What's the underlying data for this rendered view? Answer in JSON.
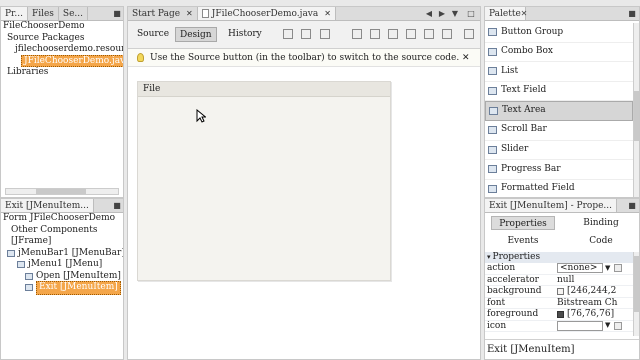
{
  "projects_panel": {
    "tabs": [
      "Pr...",
      "Files",
      "Se..."
    ],
    "tree": [
      "FileChooserDemo",
      "Source Packages",
      "jfilechooserdemo.resource",
      "JFileChooserDemo.java",
      "Libraries"
    ],
    "selected_index": 3
  },
  "navigator_panel": {
    "title": "Exit [JMenuItem...",
    "tree": [
      "Form JFileChooserDemo",
      "Other Components",
      "[JFrame]",
      "jMenuBar1 [JMenuBar]",
      "jMenu1 [JMenu]",
      "Open [JMenuItem]",
      "Exit [JMenuItem]"
    ],
    "selected_index": 6
  },
  "editor": {
    "tabs": [
      "Start Page",
      "JFileChooserDemo.java"
    ],
    "views": [
      "Source",
      "Design",
      "History"
    ],
    "active_view": "Design",
    "info": "Use the Source button (in the toolbar) to switch to the source code.",
    "menu_label": "File"
  },
  "palette": {
    "title": "Palette",
    "items": [
      "Button Group",
      "Combo Box",
      "List",
      "Text Field",
      "Text Area",
      "Scroll Bar",
      "Slider",
      "Progress Bar",
      "Formatted Field"
    ],
    "highlight": "Text Area"
  },
  "properties": {
    "title": "Exit [JMenuItem] - Prope...",
    "tabs": [
      "Properties",
      "Binding",
      "Events",
      "Code"
    ],
    "section": "Properties",
    "rows": [
      {
        "key": "action",
        "value": "<none>"
      },
      {
        "key": "accelerator",
        "value": "null"
      },
      {
        "key": "background",
        "value": "[246,244,2"
      },
      {
        "key": "font",
        "value": "Bitstream Ch"
      },
      {
        "key": "foreground",
        "value": "[76,76,76]"
      },
      {
        "key": "icon",
        "value": ""
      }
    ],
    "swatch_colors": {
      "background": "#f6f4f2",
      "foreground": "#4c4c4c"
    },
    "footer": "Exit [JMenuItem]"
  }
}
